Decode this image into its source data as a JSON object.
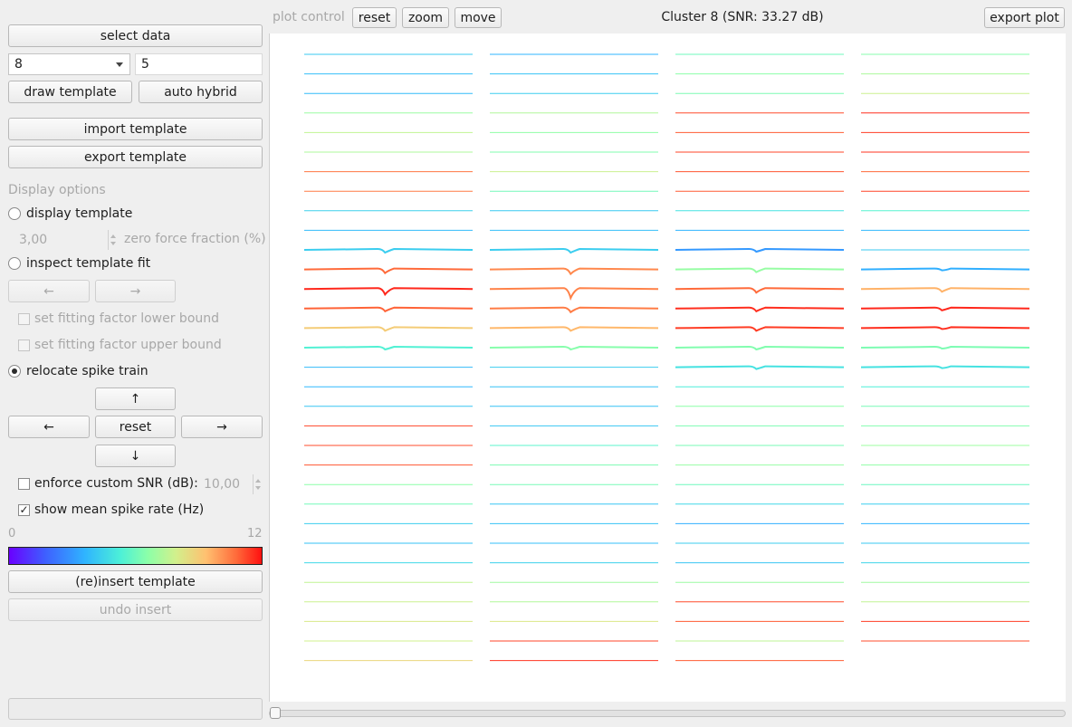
{
  "left_panel": {
    "select_data": "select data",
    "cluster_select": "8",
    "cluster_input": "5",
    "draw_template": "draw template",
    "auto_hybrid": "auto hybrid",
    "import_template": "import template",
    "export_template": "export template",
    "display_options_heading": "Display options",
    "display_template": "display template",
    "zero_force_value": "3,00",
    "zero_force_label": "zero force fraction (%)",
    "inspect_template_fit": "inspect template fit",
    "prev_arrow": "←",
    "next_arrow": "→",
    "fit_lower_label": "set fitting factor lower bound",
    "fit_upper_label": "set fitting factor upper bound",
    "relocate_label": "relocate spike train",
    "up_arrow": "↑",
    "left_arrow": "←",
    "reset_label": "reset",
    "right_arrow": "→",
    "down_arrow": "↓",
    "enforce_snr_label": "enforce custom SNR (dB):",
    "snr_value": "10,00",
    "show_rate_label": "show mean spike rate (Hz)",
    "colorbar_min": "0",
    "colorbar_max": "12",
    "reinsert": "(re)insert template",
    "undo_insert": "undo insert",
    "radio_state": {
      "display_template": false,
      "inspect_template_fit": false,
      "relocate_spike_train": true
    },
    "checkbox_state": {
      "set_lower": false,
      "set_upper": false,
      "enforce_snr": false,
      "show_rate": true
    }
  },
  "toolbar": {
    "plot_control": "plot control",
    "reset": "reset",
    "zoom": "zoom",
    "move": "move",
    "plot_title": "Cluster 8 (SNR: 33.27 dB)",
    "export_plot": "export plot"
  },
  "probe_plot": {
    "columns": 4,
    "rows": 32,
    "color_scale": {
      "min": 0,
      "max": 12,
      "unit": "Hz"
    },
    "rates": [
      [
        4.2,
        3.6,
        6.0,
        6.5
      ],
      [
        3.9,
        4.0,
        6.6,
        7.2
      ],
      [
        3.8,
        4.3,
        6.3,
        7.8
      ],
      [
        6.9,
        7.3,
        11.2,
        11.6
      ],
      [
        7.6,
        6.7,
        11.0,
        11.4
      ],
      [
        7.2,
        6.4,
        11.3,
        11.5
      ],
      [
        10.6,
        7.8,
        11.1,
        10.8
      ],
      [
        10.5,
        6.1,
        11.0,
        11.3
      ],
      [
        4.4,
        4.2,
        4.9,
        5.5
      ],
      [
        3.8,
        3.9,
        3.6,
        3.7
      ],
      [
        4.3,
        4.3,
        3.0,
        4.2
      ],
      [
        10.8,
        10.3,
        6.8,
        3.5
      ],
      [
        11.7,
        10.4,
        10.8,
        9.6
      ],
      [
        10.9,
        10.5,
        11.6,
        11.7
      ],
      [
        9.0,
        9.5,
        11.4,
        11.6
      ],
      [
        5.4,
        6.5,
        6.4,
        6.3
      ],
      [
        3.8,
        4.3,
        4.9,
        4.9
      ],
      [
        3.7,
        4.0,
        5.2,
        5.3
      ],
      [
        4.1,
        4.0,
        6.6,
        6.2
      ],
      [
        11.3,
        4.1,
        6.3,
        6.4
      ],
      [
        11.2,
        5.6,
        6.2,
        6.9
      ],
      [
        11.1,
        6.3,
        6.8,
        6.7
      ],
      [
        6.6,
        6.2,
        6.0,
        5.9
      ],
      [
        6.1,
        4.1,
        4.6,
        4.3
      ],
      [
        4.3,
        4.0,
        3.5,
        3.6
      ],
      [
        4.0,
        3.9,
        4.3,
        4.2
      ],
      [
        4.6,
        4.4,
        4.1,
        4.5
      ],
      [
        7.6,
        7.0,
        6.9,
        7.0
      ],
      [
        7.8,
        7.3,
        11.2,
        7.6
      ],
      [
        8.1,
        8.2,
        11.0,
        11.4
      ],
      [
        7.9,
        11.3,
        7.5,
        11.2
      ],
      [
        8.7,
        11.5,
        11.0,
        0
      ]
    ],
    "spike_amplitude": [
      [
        0,
        0,
        0,
        0
      ],
      [
        0,
        0,
        0,
        0
      ],
      [
        0,
        0,
        0,
        0
      ],
      [
        0,
        0,
        0,
        0
      ],
      [
        0,
        0,
        0,
        0
      ],
      [
        0,
        0,
        0,
        0
      ],
      [
        0,
        0,
        0,
        0
      ],
      [
        0,
        0,
        0,
        0
      ],
      [
        0,
        0,
        0,
        0
      ],
      [
        0,
        0,
        0,
        0
      ],
      [
        3,
        3,
        2,
        0
      ],
      [
        4,
        5,
        3,
        1
      ],
      [
        6,
        10,
        4,
        3
      ],
      [
        3,
        4,
        3,
        2
      ],
      [
        3,
        3,
        3,
        1
      ],
      [
        2,
        2,
        2,
        1
      ],
      [
        0,
        0,
        2,
        1
      ],
      [
        0,
        0,
        0,
        0
      ],
      [
        0,
        0,
        0,
        0
      ],
      [
        0,
        0,
        0,
        0
      ],
      [
        0,
        0,
        0,
        0
      ],
      [
        0,
        0,
        0,
        0
      ],
      [
        0,
        0,
        0,
        0
      ],
      [
        0,
        0,
        0,
        0
      ],
      [
        0,
        0,
        0,
        0
      ],
      [
        0,
        0,
        0,
        0
      ],
      [
        0,
        0,
        0,
        0
      ],
      [
        0,
        0,
        0,
        0
      ],
      [
        0,
        0,
        0,
        0
      ],
      [
        0,
        0,
        0,
        0
      ],
      [
        0,
        0,
        0,
        0
      ],
      [
        0,
        0,
        0,
        0
      ]
    ]
  }
}
